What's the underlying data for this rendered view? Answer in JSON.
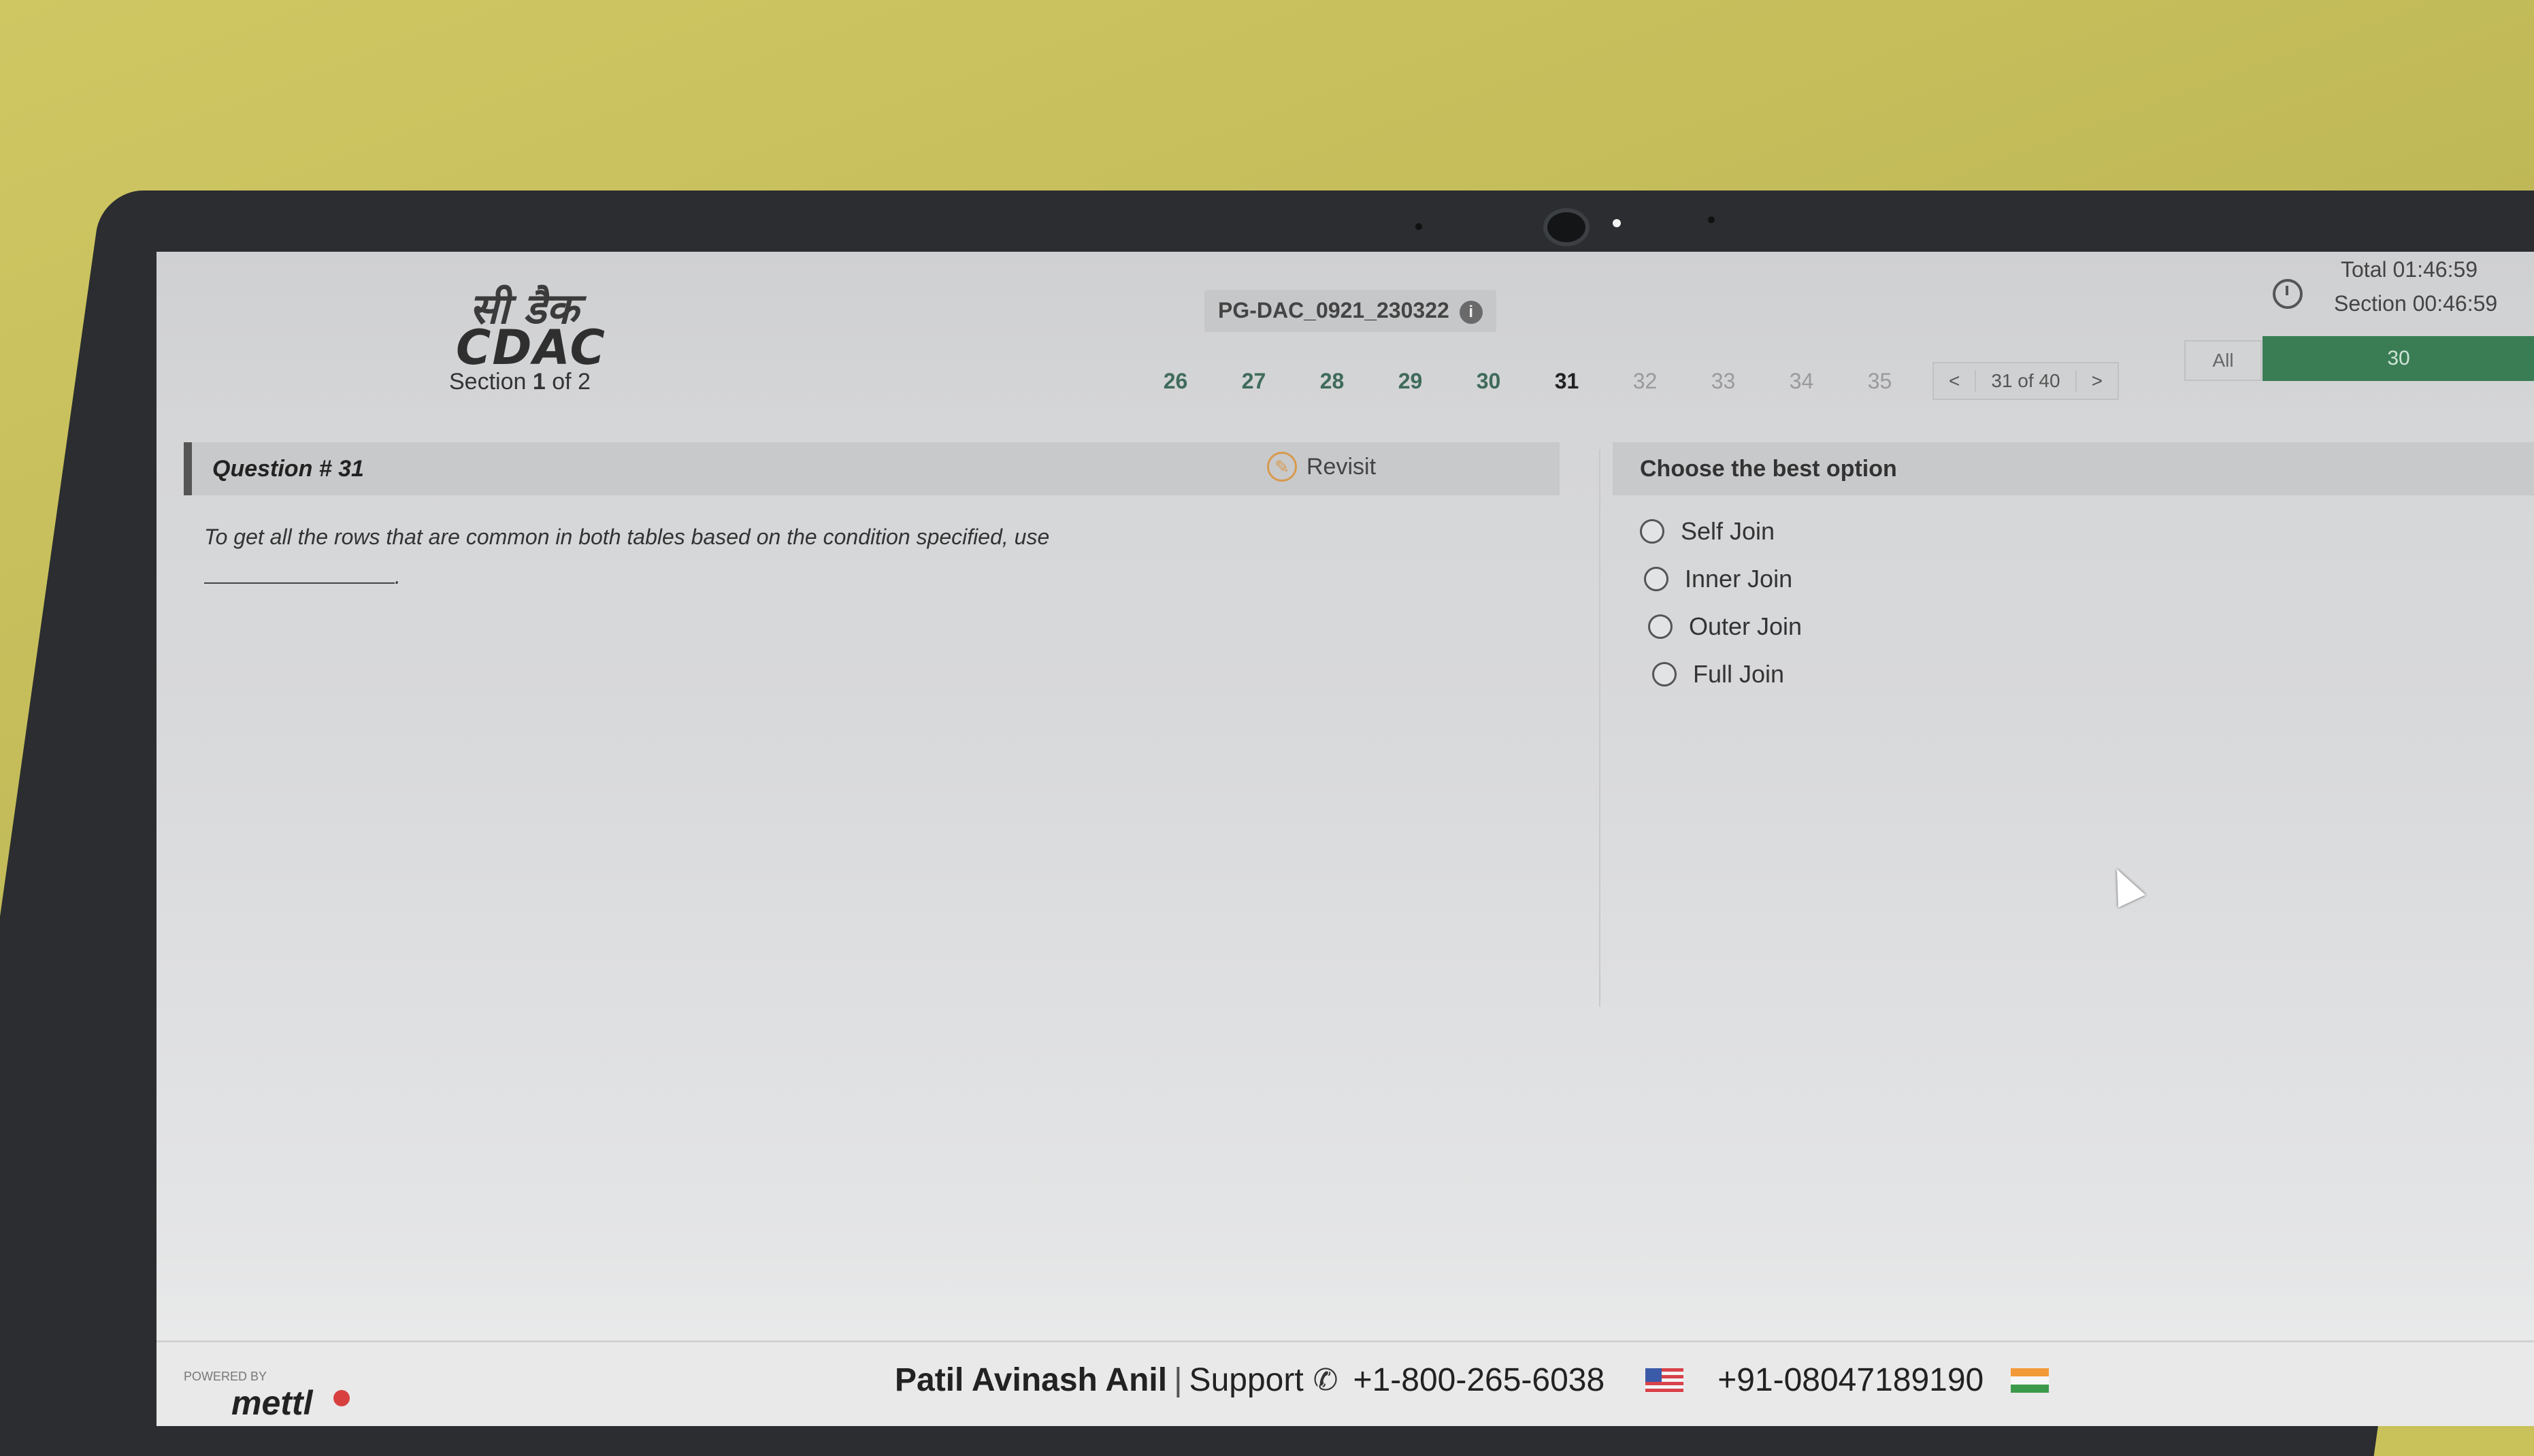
{
  "header": {
    "logo_hindi": "सी डैक",
    "logo_cdac": "CDAC",
    "section_prefix": "Section",
    "section_current": "1",
    "section_suffix": "of 2",
    "exam_code": "PG-DAC_0921_230322",
    "timer_total": "Total 01:46:59",
    "timer_section": "Section 00:46:59",
    "filter_all_label": "All",
    "filter_count": "30"
  },
  "question_nav": {
    "numbers": [
      "26",
      "27",
      "28",
      "29",
      "30",
      "31",
      "32",
      "33",
      "34",
      "35"
    ],
    "current": "31",
    "prev_label": "<",
    "pager_text": "31 of 40",
    "next_label": ">"
  },
  "question": {
    "title": "Question # 31",
    "revisit_label": "Revisit",
    "text": "To get all the rows that are common in both tables based on the condition specified, use",
    "blank_suffix": "."
  },
  "options": {
    "heading": "Choose the best option",
    "items": [
      "Self Join",
      "Inner Join",
      "Outer Join",
      "Full Join"
    ]
  },
  "footer": {
    "powered_by": "POWERED BY",
    "brand": "mettl",
    "candidate_name": "Patil Avinash Anil",
    "separator": "|",
    "support_label": "Support",
    "phone_us": "+1-800-265-6038",
    "phone_in": "+91-08047189190"
  },
  "colors": {
    "answered": "#3f6b5a",
    "filter_bar": "#3a7d55",
    "revisit_accent": "#d79a4e"
  }
}
